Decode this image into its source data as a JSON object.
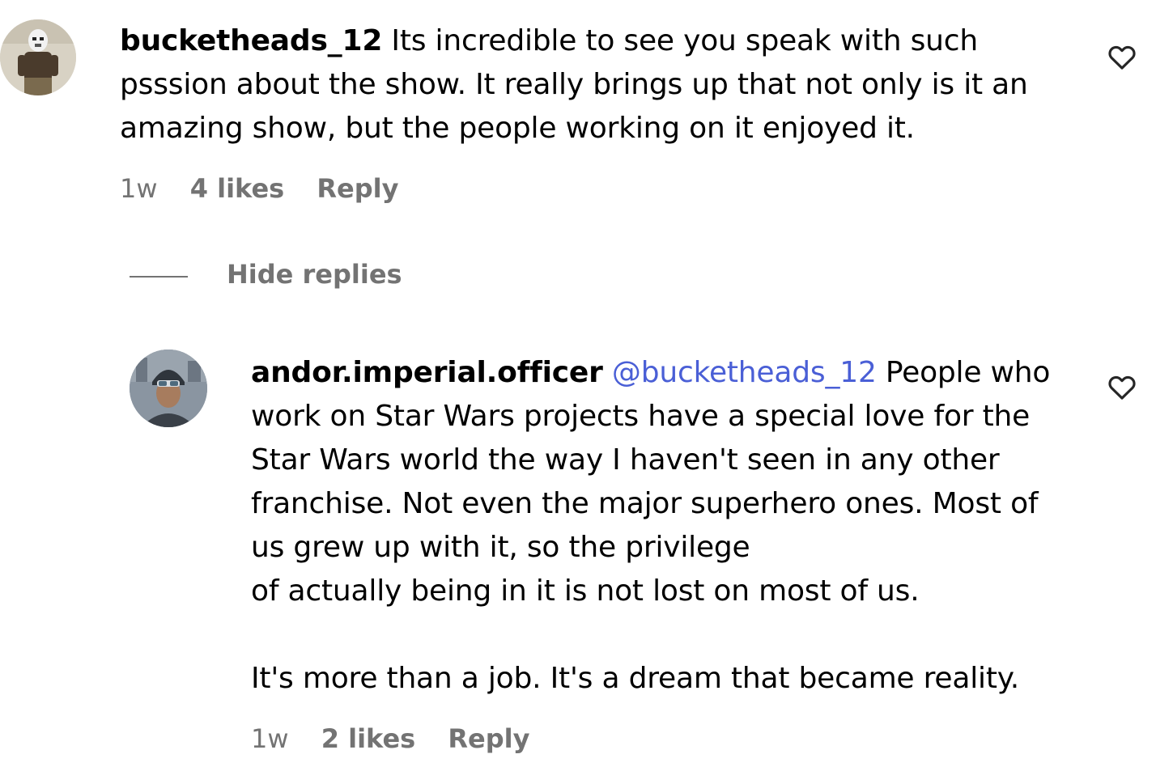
{
  "comments": [
    {
      "username": "bucketheads_12",
      "text_lines": [
        "Its incredible to see you speak with such",
        "psssion about the show. It really brings up that not only is it an",
        "amazing show, but the people working on it enjoyed it."
      ],
      "time": "1w",
      "likes": "4 likes",
      "reply_label": "Reply",
      "avatar_icon": "stormtrooper-avatar",
      "like_icon": "heart-outline-icon"
    }
  ],
  "hide_replies_label": "Hide replies",
  "replies": [
    {
      "username": "andor.imperial.officer",
      "mention": "@bucketheads_12",
      "text_lines": [
        "People who",
        "work on Star Wars projects have a special love for the",
        "Star Wars world the way I haven't seen in any other",
        "franchise. Not even the major superhero ones. Most of",
        "us grew up with it, so the privilege",
        "of actually being in it is not lost on most of us.",
        "",
        "It's more than a job. It's a dream that became reality."
      ],
      "time": "1w",
      "likes": "2 likes",
      "reply_label": "Reply",
      "avatar_icon": "imperial-officer-avatar",
      "like_icon": "heart-outline-icon"
    }
  ],
  "colors": {
    "text": "#000000",
    "secondary": "#737373",
    "mention": "#4a5fd6"
  }
}
